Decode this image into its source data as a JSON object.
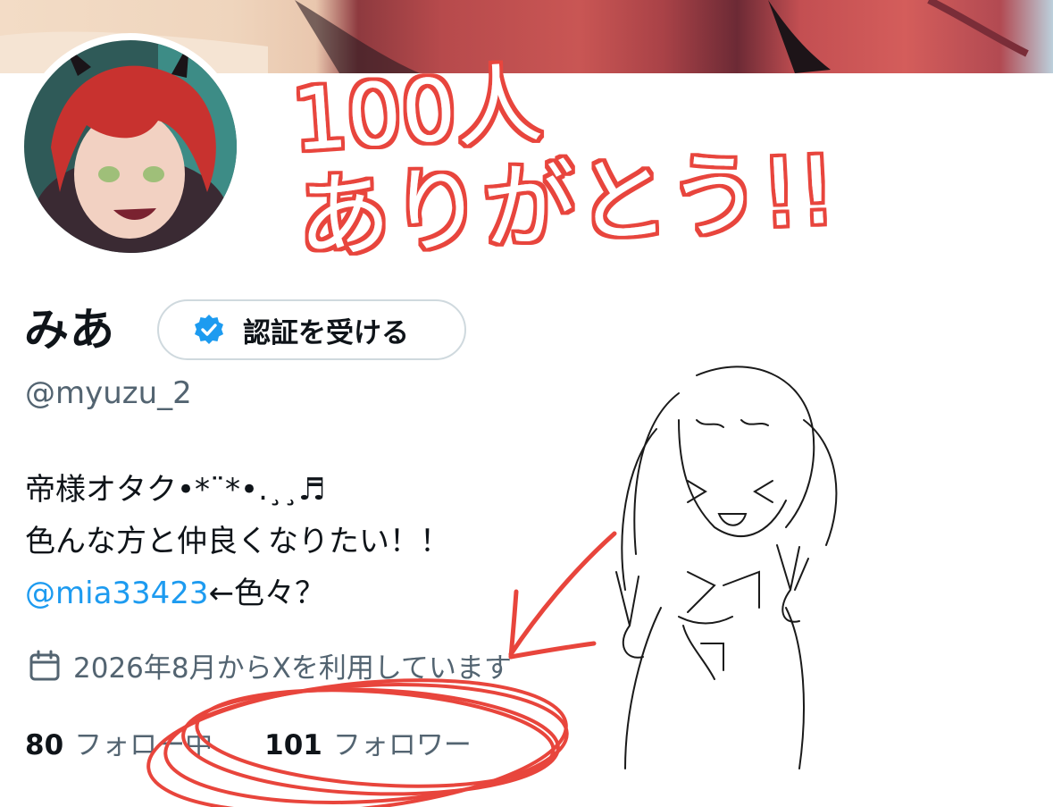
{
  "profile": {
    "display_name": "みあ",
    "handle": "@myuzu_2",
    "verify_button_label": "認証を受ける",
    "bio_line1": "帝様オタク•*¨*•.¸¸♬",
    "bio_line2": "色んな方と仲良くなりたい！！",
    "bio_mention": "@mia33423",
    "bio_line3_suffix": "←色々？",
    "joined_text": "2026年8月からXを利用しています",
    "following_count": "80",
    "following_label": "フォロー中",
    "followers_count": "101",
    "followers_label": "フォロワー"
  },
  "annotation": {
    "line1": "100人",
    "line2": "ありがとう!!"
  },
  "colors": {
    "accent": "#1d9bf0",
    "annotation_red": "#e8453c",
    "secondary_text": "#536471"
  },
  "icons": {
    "verify_badge": "verified-badge-icon",
    "joined": "calendar-icon"
  }
}
